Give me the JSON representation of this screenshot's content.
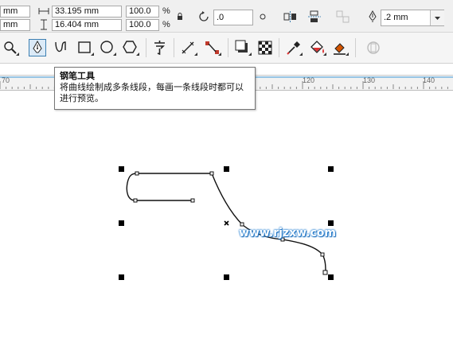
{
  "propbar": {
    "x_unit_partial": "mm",
    "y_unit_partial": "mm",
    "width": "33.195 mm",
    "height": "16.404 mm",
    "scale_x": "100.0",
    "scale_y": "100.0",
    "percent": "%",
    "rotation": ".0",
    "outline_width": ".2 mm"
  },
  "tooltip": {
    "title": "钢笔工具",
    "body": "将曲线绘制成多条线段，每画一条线段时都可以进行预览。"
  },
  "ruler": {
    "ticks": [
      "70",
      "120",
      "130",
      "140"
    ]
  },
  "watermark": "www.rjzxw.com",
  "colors": {
    "accent": "#3c7fb1",
    "ruler_line": "#3d9bd8",
    "node": "#000000",
    "watermark_glow": "#1a7ad1"
  }
}
